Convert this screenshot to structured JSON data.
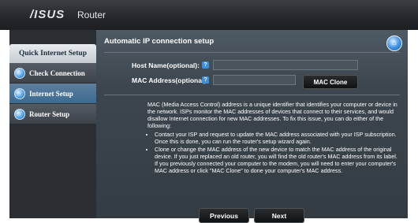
{
  "header": {
    "logo": "/ISUS",
    "title": "Router"
  },
  "sidebar": {
    "header": "Quick Internet Setup",
    "items": [
      {
        "label": "Check Connection"
      },
      {
        "label": "Internet Setup"
      },
      {
        "label": "Router Setup"
      }
    ]
  },
  "main": {
    "heading": "Automatic IP connection setup",
    "host_name": {
      "label": "Host Name(optional):",
      "help": "?",
      "value": ""
    },
    "mac_address": {
      "label": "MAC Address(optional)",
      "help": "?",
      "value": ""
    },
    "mac_clone_label": "MAC Clone",
    "info_paragraph": "MAC (Media Access Control) address is a unique identifier that identifies your computer or device in the network. ISPs monitor the MAC addresses of devices that connect to their services, and would disallow Internet connection for new MAC addresses. To fix this issue, you can do either of the following:",
    "bullets": [
      "Contact your ISP and request to update the MAC address associated with your ISP subscription. Once this is done, you can run the router's setup wizard again.",
      "Clone or change the MAC address of the new device to match the MAC address of the original device. If you just replaced an old router, you will find the old router's MAC address from its label. If you previously connected your computer to the modem, you will need to enter your computer's MAC address or click \"MAC Clone\" to done your computer's MAC address."
    ],
    "previous_label": "Previous",
    "next_label": "Next"
  },
  "colors": {
    "accent": "#3c8ee0",
    "active_nav": "#3b6a91"
  }
}
